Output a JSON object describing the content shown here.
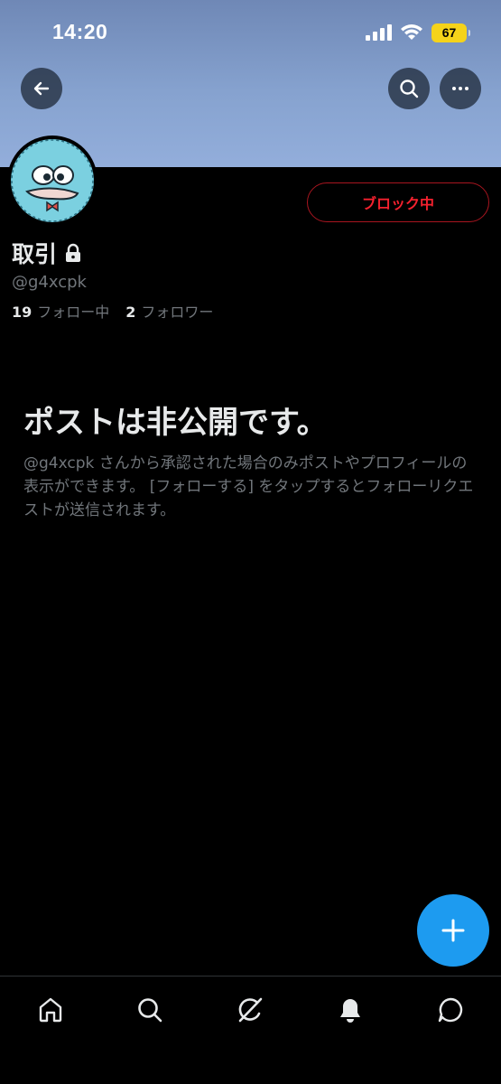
{
  "status_bar": {
    "time": "14:20",
    "battery": "67",
    "battery_color": "#f5d31a"
  },
  "header": {
    "back_icon": "arrow-left-icon",
    "search_icon": "search-icon",
    "more_icon": "more-dots-icon"
  },
  "profile": {
    "display_name": "取引",
    "protected": true,
    "handle": "@g4xcpk",
    "following_count": "19",
    "following_label": "フォロー中",
    "followers_count": "2",
    "followers_label": "フォロワー",
    "blocked_button_label": "ブロック中",
    "blocked_color": "#f4212e"
  },
  "private_notice": {
    "title": "ポストは非公開です。",
    "description": "@g4xcpk さんから承認された場合のみポストやプロフィールの表示ができます。 [フォローする] をタップするとフォローリクエストが送信されます。"
  },
  "fab": {
    "icon": "plus-icon",
    "color": "#1d9bf0"
  },
  "bottom_nav": {
    "items": [
      "home-icon",
      "search-icon",
      "grok-icon",
      "notifications-icon",
      "messages-icon"
    ]
  }
}
